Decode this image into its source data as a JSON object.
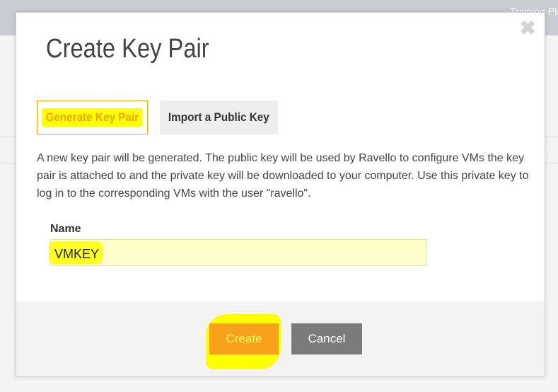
{
  "background": {
    "user_link": "Training Pla"
  },
  "modal": {
    "title": "Create Key Pair",
    "close_icon": "close-icon",
    "tabs": [
      {
        "label": "Generate Key Pair",
        "active": true
      },
      {
        "label": "Import a Public Key",
        "active": false
      }
    ],
    "description": "A new key pair will be generated. The public key will be used by Ravello to configure VMs the key pair is attached to and the private key will be downloaded to your computer. Use this private key to log in to the corresponding VMs with the user \"ravello\".",
    "name_label": "Name",
    "name_value": "VMKEY",
    "buttons": {
      "create": "Create",
      "cancel": "Cancel"
    }
  },
  "colors": {
    "accent": "#f7a21a",
    "highlight": "#ffff00",
    "input_bg": "#ffffcc",
    "cancel": "#7b7b7b"
  }
}
